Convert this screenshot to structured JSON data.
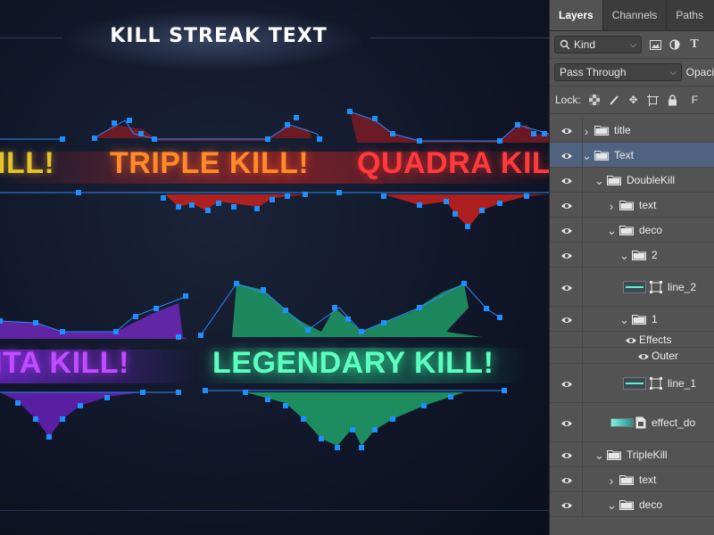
{
  "canvas": {
    "title": "KILL STREAK TEXT",
    "labels": {
      "double": "KILL!",
      "triple": "TRIPLE KILL!",
      "quadra": "QUADRA KILL!",
      "penta": "NTA KILL!",
      "legendary": "LEGENDARY KILL!"
    },
    "colors": {
      "double": "#e6c22a",
      "triple": "#ff8a2a",
      "quadra": "#ff3a3a",
      "penta": "#c14cff",
      "legendary": "#5cffc0",
      "anchor": "#1e8fff"
    }
  },
  "panel": {
    "tabs": [
      "Layers",
      "Channels",
      "Paths"
    ],
    "filter_kind": "Kind",
    "blend_mode": "Pass Through",
    "opacity_label": "Opaci",
    "lock_label": "Lock:",
    "fill_label": "F",
    "layers": [
      {
        "name": "title",
        "type": "folder",
        "indent": 0,
        "expanded": false,
        "selected": false
      },
      {
        "name": "Text",
        "type": "folder",
        "indent": 0,
        "expanded": true,
        "selected": true
      },
      {
        "name": "DoubleKill",
        "type": "folder",
        "indent": 1,
        "expanded": true,
        "selected": false
      },
      {
        "name": "text",
        "type": "folder",
        "indent": 2,
        "expanded": false,
        "selected": false
      },
      {
        "name": "deco",
        "type": "folder",
        "indent": 2,
        "expanded": true,
        "selected": false
      },
      {
        "name": "2",
        "type": "folder",
        "indent": 3,
        "expanded": true,
        "selected": false
      },
      {
        "name": "line_2",
        "type": "shape",
        "indent": 4,
        "selected": false
      },
      {
        "name": "1",
        "type": "folder",
        "indent": 3,
        "expanded": true,
        "selected": false
      },
      {
        "name": "Effects",
        "type": "effects",
        "indent": 4,
        "selected": false
      },
      {
        "name": "Outer",
        "type": "effect",
        "indent": 5,
        "selected": false
      },
      {
        "name": "line_1",
        "type": "shape",
        "indent": 4,
        "selected": false
      },
      {
        "name": "effect_do",
        "type": "smart",
        "indent": 3,
        "selected": false
      },
      {
        "name": "TripleKill",
        "type": "folder",
        "indent": 1,
        "expanded": true,
        "selected": false
      },
      {
        "name": "text",
        "type": "folder",
        "indent": 2,
        "expanded": false,
        "selected": false
      },
      {
        "name": "deco",
        "type": "folder",
        "indent": 2,
        "expanded": true,
        "selected": false
      }
    ]
  }
}
